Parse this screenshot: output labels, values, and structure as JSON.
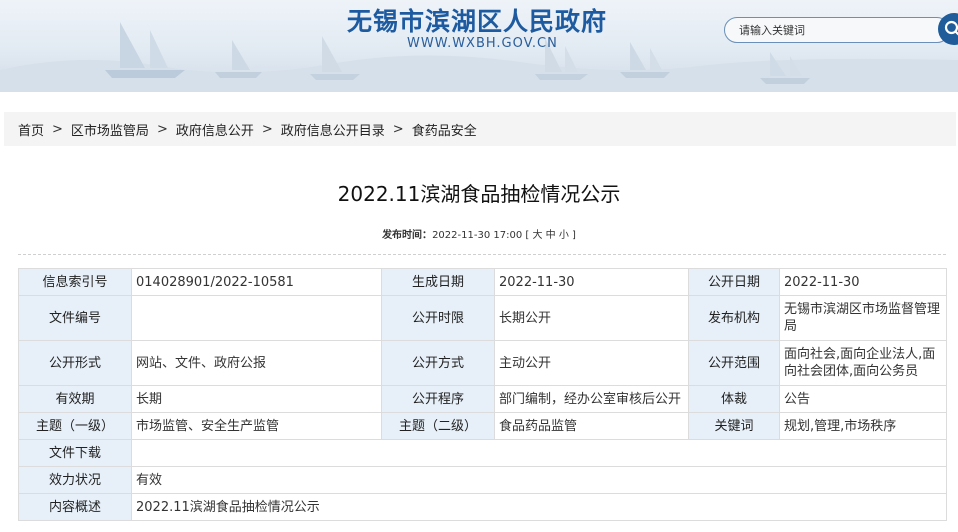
{
  "header": {
    "site_title": "无锡市滨湖区人民政府",
    "site_url": "WWW.WXBH.GOV.CN",
    "search_placeholder": "请输入关键词",
    "search_icon": "search-icon"
  },
  "breadcrumb": [
    "首页",
    "区市场监管局",
    "政府信息公开",
    "政府信息公开目录",
    "食药品安全"
  ],
  "breadcrumb_separator": ">",
  "article": {
    "title": "2022.11滨湖食品抽检情况公示",
    "publish_label": "发布时间：",
    "publish_time": "2022-11-30 17:00",
    "size_open": "[",
    "size_large": "大",
    "size_medium": "中",
    "size_small": "小",
    "size_close": "]"
  },
  "info": {
    "index_no_label": "信息索引号",
    "index_no": "014028901/2022-10581",
    "generate_date_label": "生成日期",
    "generate_date": "2022-11-30",
    "public_date_label": "公开日期",
    "public_date": "2022-11-30",
    "doc_no_label": "文件编号",
    "doc_no": "",
    "time_limit_label": "公开时限",
    "time_limit": "长期公开",
    "publisher_label": "发布机构",
    "publisher": "无锡市滨湖区市场监督管理局",
    "form_label": "公开形式",
    "form": "网站、文件、政府公报",
    "method_label": "公开方式",
    "method": "主动公开",
    "scope_label": "公开范围",
    "scope": "面向社会,面向企业法人,面向社会团体,面向公务员",
    "validity_label": "有效期",
    "validity": "长期",
    "procedure_label": "公开程序",
    "procedure": "部门编制，经办公室审核后公开",
    "genre_label": "体裁",
    "genre": "公告",
    "topic1_label": "主题（一级）",
    "topic1": "市场监管、安全生产监管",
    "topic2_label": "主题（二级）",
    "topic2": "食品药品监管",
    "keywords_label": "关键词",
    "keywords": "规划,管理,市场秩序",
    "download_label": "文件下载",
    "download": "",
    "status_label": "效力状况",
    "status": "有效",
    "summary_label": "内容概述",
    "summary": "2022.11滨湖食品抽检情况公示"
  },
  "colors": {
    "banner_title": "#1e5aa0",
    "label_cell_bg": "#e7f0f9",
    "search_button": "#1f5c99"
  }
}
